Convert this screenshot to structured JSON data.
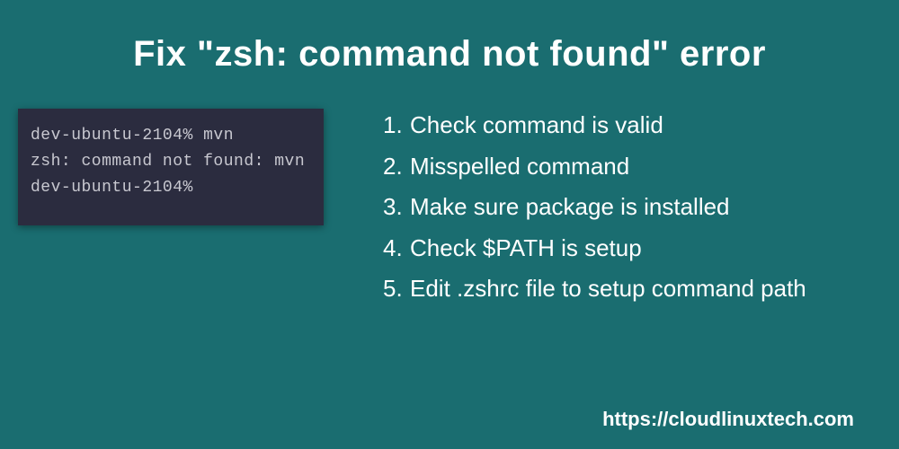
{
  "title": "Fix \"zsh: command not found\" error",
  "terminal": {
    "line1": "dev-ubuntu-2104% mvn",
    "line2": "zsh: command not found: mvn",
    "line3": "dev-ubuntu-2104%"
  },
  "steps": {
    "items": [
      {
        "num": "1.",
        "text": "Check command is valid"
      },
      {
        "num": "2.",
        "text": "Misspelled command"
      },
      {
        "num": "3.",
        "text": "Make sure package is installed"
      },
      {
        "num": "4.",
        "text": "Check $PATH is setup"
      },
      {
        "num": "5.",
        "text": "Edit .zshrc file to setup command path"
      }
    ]
  },
  "footer": "https://cloudlinuxtech.com"
}
